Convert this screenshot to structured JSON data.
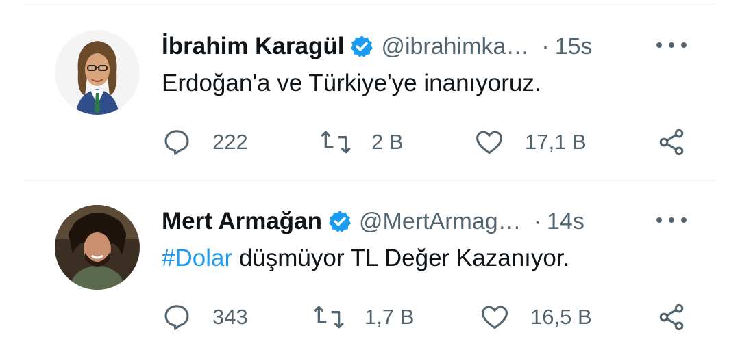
{
  "tweets": [
    {
      "name": "İbrahim Karagül",
      "handle": "@ibrahimka…",
      "separator": "·",
      "time": "15s",
      "text_parts": {
        "hashtag": "",
        "rest": "Erdoğan'a ve Türkiye'ye inanıyoruz."
      },
      "replies": "222",
      "retweets": "2 B",
      "likes": "17,1 B",
      "verified": true,
      "avatar_icon": "person-avatar-suit"
    },
    {
      "name": "Mert Armağan",
      "handle": "@MertArmag…",
      "separator": "·",
      "time": "14s",
      "text_parts": {
        "hashtag": "#Dolar",
        "rest": " düşmüyor TL Değer Kazanıyor."
      },
      "replies": "343",
      "retweets": "1,7 B",
      "likes": "16,5 B",
      "verified": true,
      "avatar_icon": "person-avatar-curly-hair"
    }
  ],
  "colors": {
    "verified_badge": "#1d9bf0",
    "hashtag": "#1d9bf0",
    "secondary_text": "#536471",
    "primary_text": "#0f1419"
  }
}
